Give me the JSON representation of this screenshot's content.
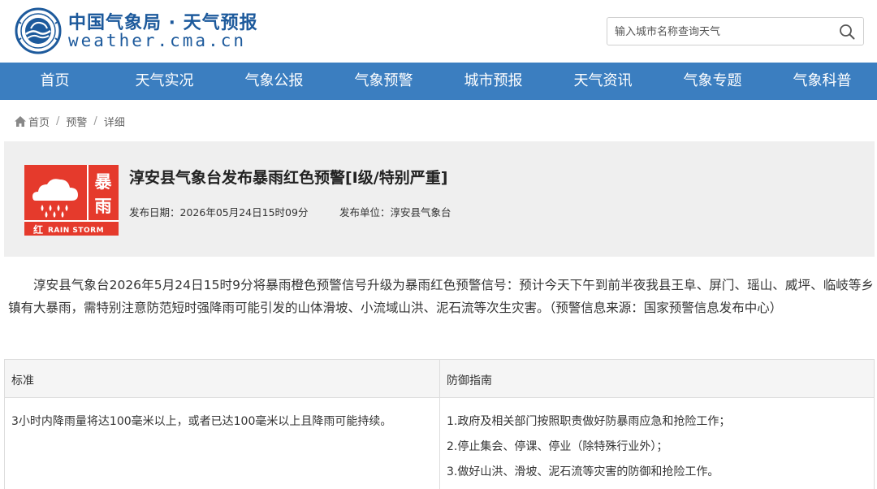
{
  "header": {
    "site_name_cn": "中国气象局 · 天气预报",
    "site_name_en": "weather.cma.cn",
    "logo_icon": "cma-emblem-icon",
    "search": {
      "placeholder": "输入城市名称查询天气",
      "value": "",
      "icon": "search-icon"
    }
  },
  "nav": {
    "items": [
      {
        "label": "首页"
      },
      {
        "label": "天气实况"
      },
      {
        "label": "气象公报"
      },
      {
        "label": "气象预警"
      },
      {
        "label": "城市预报"
      },
      {
        "label": "天气资讯"
      },
      {
        "label": "气象专题"
      },
      {
        "label": "气象科普"
      }
    ]
  },
  "breadcrumb": {
    "icon": "home-icon",
    "items": [
      {
        "label": "首页"
      },
      {
        "label": "预警"
      },
      {
        "label": "详细"
      }
    ]
  },
  "alert": {
    "title": "淳安县气象台发布暴雨红色预警[Ⅰ级/特别严重]",
    "icon": {
      "name": "rainstorm-red-warning-icon",
      "text_cn_top": "暴",
      "text_cn_bottom": "雨",
      "level_cn": "红",
      "text_en": "RAIN STORM",
      "color": "#e53a2c"
    },
    "issued_time_label": "发布日期：",
    "issued_time": "2026年05月24日15时09分",
    "issuer_label": "发布单位：",
    "issuer": "淳安县气象台"
  },
  "content": {
    "paragraph": "淳安县气象台2026年5月24日15时9分将暴雨橙色预警信号升级为暴雨红色预警信号：预计今天下午到前半夜我县王阜、屏门、瑶山、威坪、临岐等乡镇有大暴雨，需特别注意防范短时强降雨可能引发的山体滑坡、小流域山洪、泥石流等次生灾害。（预警信息来源：国家预警信息发布中心）"
  },
  "table": {
    "headers": {
      "standard": "标准",
      "guide": "防御指南"
    },
    "standard": "3小时内降雨量将达100毫米以上，或者已达100毫米以上且降雨可能持续。",
    "guide": [
      "1.政府及相关部门按照职责做好防暴雨应急和抢险工作；",
      "2.停止集会、停课、停业（除特殊行业外）；",
      "3.做好山洪、滑坡、泥石流等灾害的防御和抢险工作。"
    ]
  },
  "colors": {
    "brand_blue": "#1d5a9c",
    "nav_bg": "#3b7ec0",
    "alert_red": "#e53a2c",
    "panel_bg": "#efefef"
  }
}
